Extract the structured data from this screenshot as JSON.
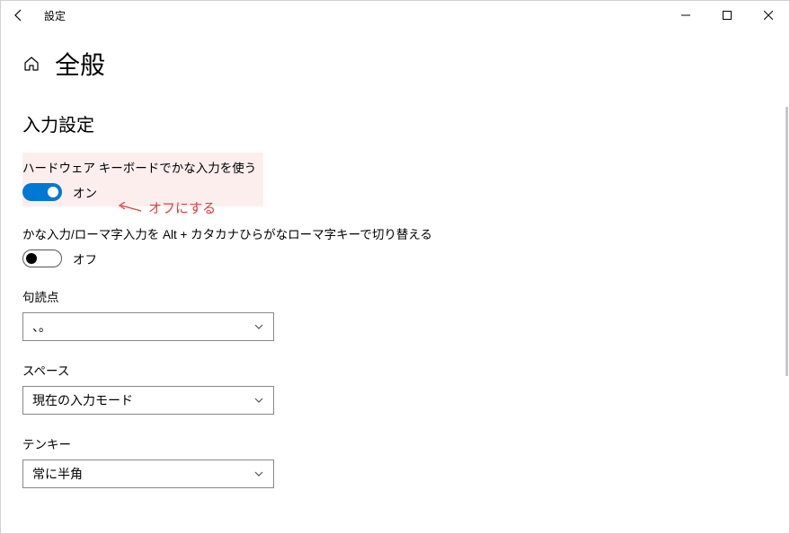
{
  "window": {
    "title": "設定"
  },
  "page": {
    "title": "全般"
  },
  "section": {
    "heading": "入力設定"
  },
  "settings": {
    "kana_hw": {
      "label": "ハードウェア キーボードでかな入力を使う",
      "state": "オン"
    },
    "alt_toggle": {
      "label": "かな入力/ローマ字入力を Alt + カタカナひらがなローマ字キーで切り替える",
      "state": "オフ"
    }
  },
  "annotation": {
    "text": "オフにする"
  },
  "fields": {
    "punctuation": {
      "label": "句読点",
      "value": "、。"
    },
    "space": {
      "label": "スペース",
      "value": "現在の入力モード"
    },
    "tenkey": {
      "label": "テンキー",
      "value": "常に半角"
    }
  }
}
